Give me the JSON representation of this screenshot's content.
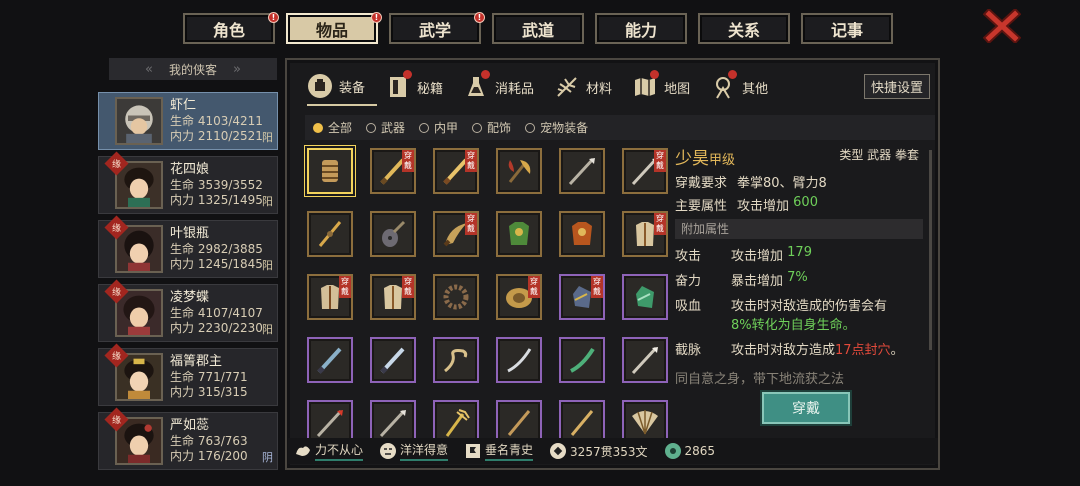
{
  "top_tabs": [
    {
      "label": "角色",
      "active": false,
      "badge": "!"
    },
    {
      "label": "物品",
      "active": true,
      "badge": "!"
    },
    {
      "label": "武学",
      "active": false,
      "badge": "!"
    },
    {
      "label": "武道",
      "active": false,
      "badge": ""
    },
    {
      "label": "能力",
      "active": false,
      "badge": ""
    },
    {
      "label": "关系",
      "active": false,
      "badge": ""
    },
    {
      "label": "记事",
      "active": false,
      "badge": ""
    }
  ],
  "heroes_header": "我的侠客",
  "heroes": [
    {
      "name": "虾仁",
      "hp": "生命 4103/4211",
      "mp": "内力 2110/2521",
      "align": "阳",
      "yuan": "",
      "selected": true
    },
    {
      "name": "花四娘",
      "hp": "生命 3539/3552",
      "mp": "内力 1325/1495",
      "align": "阳",
      "yuan": "缘",
      "selected": false
    },
    {
      "name": "叶银瓶",
      "hp": "生命 2982/3885",
      "mp": "内力 1245/1845",
      "align": "阳",
      "yuan": "缘",
      "selected": false
    },
    {
      "name": "凌梦蝶",
      "hp": "生命 4107/4107",
      "mp": "内力 2230/2230",
      "align": "阳",
      "yuan": "缘",
      "selected": false
    },
    {
      "name": "福箐郡主",
      "hp": "生命 771/771",
      "mp": "内力 315/315",
      "align": "",
      "yuan": "缘",
      "selected": false
    },
    {
      "name": "严如蕊",
      "hp": "生命 763/763",
      "mp": "内力 176/200",
      "align": "阴",
      "yuan": "缘",
      "selected": false
    }
  ],
  "sub_tabs": [
    "装备",
    "秘籍",
    "消耗品",
    "材料",
    "地图",
    "其他"
  ],
  "quick_settings": "快捷设置",
  "filters": [
    {
      "label": "全部",
      "on": true
    },
    {
      "label": "武器",
      "on": false
    },
    {
      "label": "内甲",
      "on": false
    },
    {
      "label": "配饰",
      "on": false
    },
    {
      "label": "宠物装备",
      "on": false
    }
  ],
  "equip_tag": "穿戴",
  "detail": {
    "name": "少昊",
    "grade": "甲级",
    "type": "类型  武器 拳套",
    "req_label": "穿戴要求",
    "req_value": "拳掌80、臂力8",
    "main_label": "主要属性",
    "main_value": "攻击增加 ",
    "main_num": "600",
    "extra_header": "附加属性",
    "a1_label": "攻击",
    "a1_value": "攻击增加 ",
    "a1_num": "179",
    "a2_label": "奋力",
    "a2_value": "暴击增加 ",
    "a2_num": "7%",
    "a3_label": "吸血",
    "a3_line1": "攻击时对敌造成的伤害会有",
    "a3_line2": "8%转化为自身生命。",
    "a4_label": "截脉",
    "a4_value": "攻击时对敌方造成",
    "a4_red": "17点封穴",
    "a4_end": "。",
    "cut_text": "同自意之身，带下地流获之法"
  },
  "wear_button": "穿戴",
  "bottom": [
    {
      "icon": "muscle-icon",
      "text": "力不从心"
    },
    {
      "icon": "face-icon",
      "text": "洋洋得意"
    },
    {
      "icon": "flag-icon",
      "text": "垂名青史"
    },
    {
      "icon": "coin-icon",
      "text": "3257贯353文"
    },
    {
      "icon": "jade-icon",
      "text": "2865"
    }
  ],
  "colors": {
    "accent": "#e3b85a",
    "tab_active": "#d8c9a6",
    "badge": "#c4312b",
    "button": "#3f8f84"
  }
}
